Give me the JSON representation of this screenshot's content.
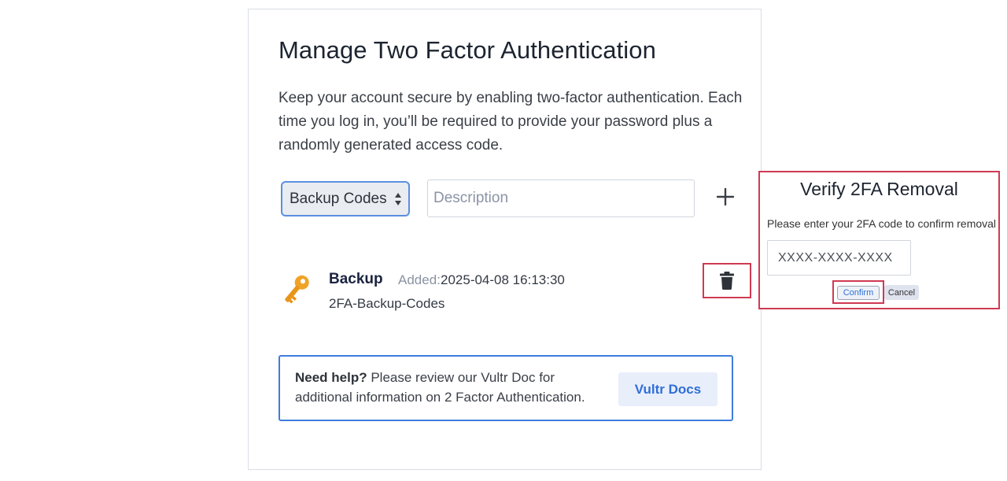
{
  "card": {
    "title": "Manage Two Factor Authentication",
    "description": "Keep your account secure by enabling two-factor authentication. Each time you log in, you’ll be required to provide your password plus a randomly generated access code."
  },
  "form": {
    "type_select_value": "Backup Codes",
    "description_placeholder": "Description",
    "add_icon": "plus-icon"
  },
  "entry": {
    "icon": "key-icon",
    "name": "Backup",
    "added_label": "Added:",
    "added_value": "2025-04-08 16:13:30",
    "subtitle": "2FA-Backup-Codes",
    "delete_icon": "trash-icon"
  },
  "help": {
    "bold": "Need help?",
    "text": " Please review our Vultr Doc for additional information on 2 Factor Authentication.",
    "button": "Vultr Docs"
  },
  "verify": {
    "title": "Verify 2FA Removal",
    "message": "Please enter your 2FA code to confirm removal",
    "code_placeholder": "XXXX-XXXX-XXXX",
    "confirm": "Confirm",
    "cancel": "Cancel"
  },
  "colors": {
    "accent": "#2f6fd6",
    "highlight": "#cf3a52",
    "key": "#f0a326"
  }
}
